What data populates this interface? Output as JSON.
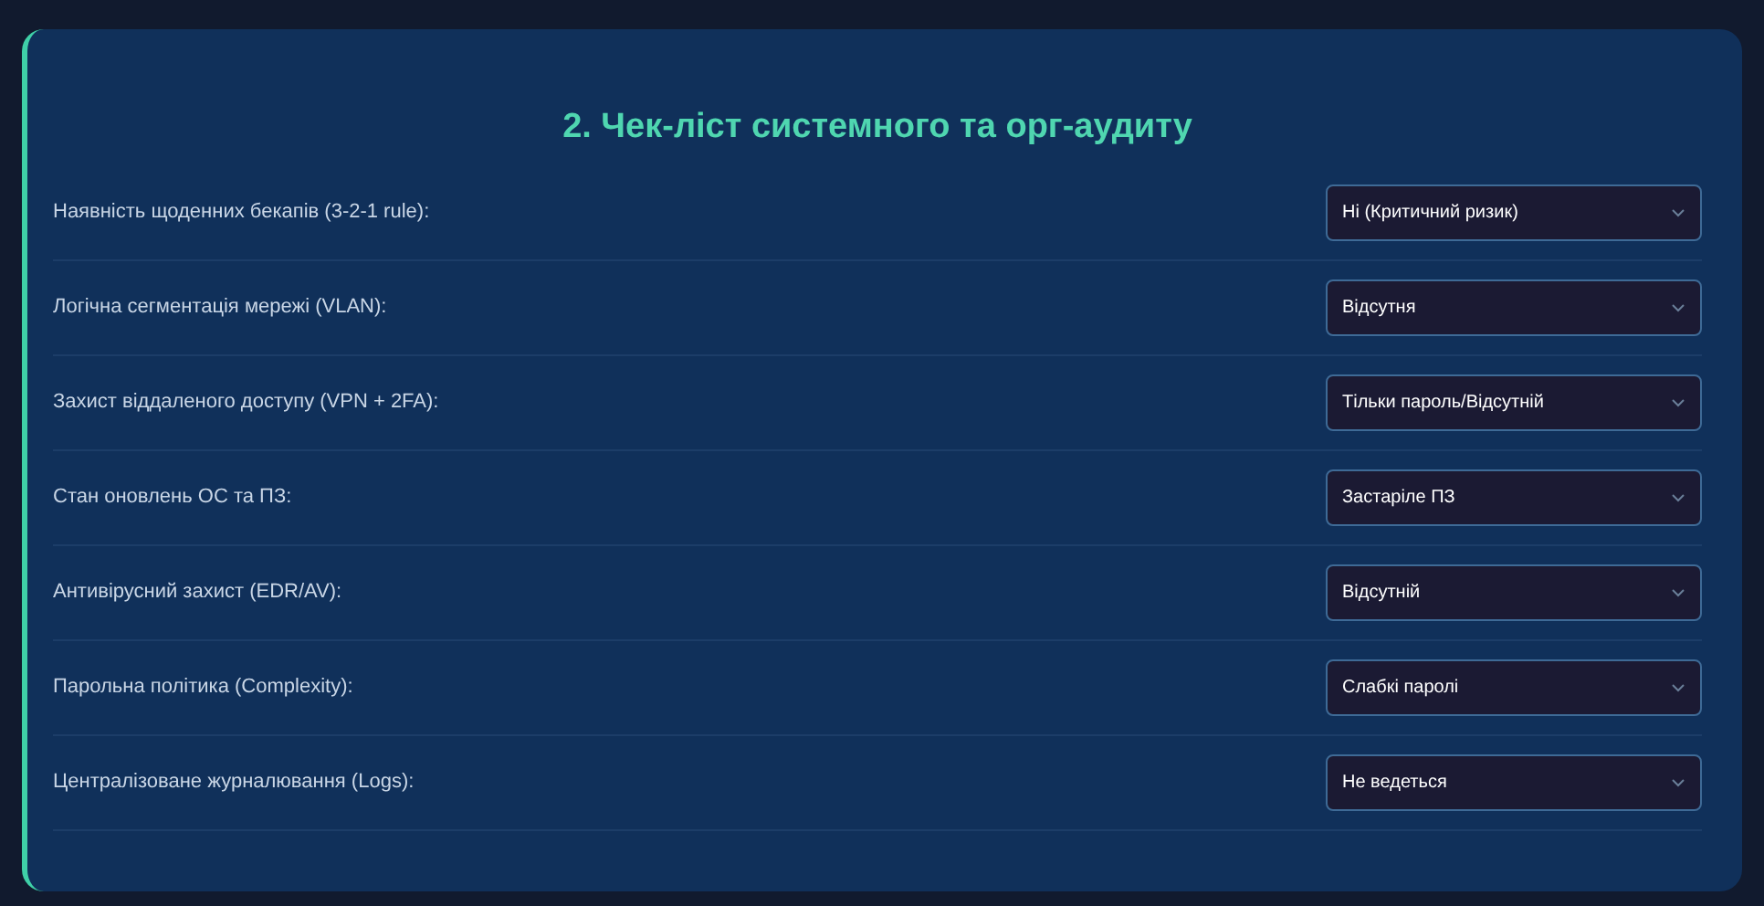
{
  "section": {
    "title": "2. Чек-ліст системного та орг-аудиту",
    "items": [
      {
        "label": "Наявність щоденних бекапів (3-2-1 rule):",
        "value": "Ні (Критичний ризик)"
      },
      {
        "label": "Логічна сегментація мережі (VLAN):",
        "value": "Відсутня"
      },
      {
        "label": "Захист віддаленого доступу (VPN + 2FA):",
        "value": "Тільки пароль/Відсутній"
      },
      {
        "label": "Стан оновлень ОС та ПЗ:",
        "value": "Застаріле ПЗ"
      },
      {
        "label": "Антивірусний захист (EDR/AV):",
        "value": "Відсутній"
      },
      {
        "label": "Парольна політика (Complexity):",
        "value": "Слабкі паролі"
      },
      {
        "label": "Централізоване журналювання (Logs):",
        "value": "Не ведеться"
      }
    ]
  }
}
